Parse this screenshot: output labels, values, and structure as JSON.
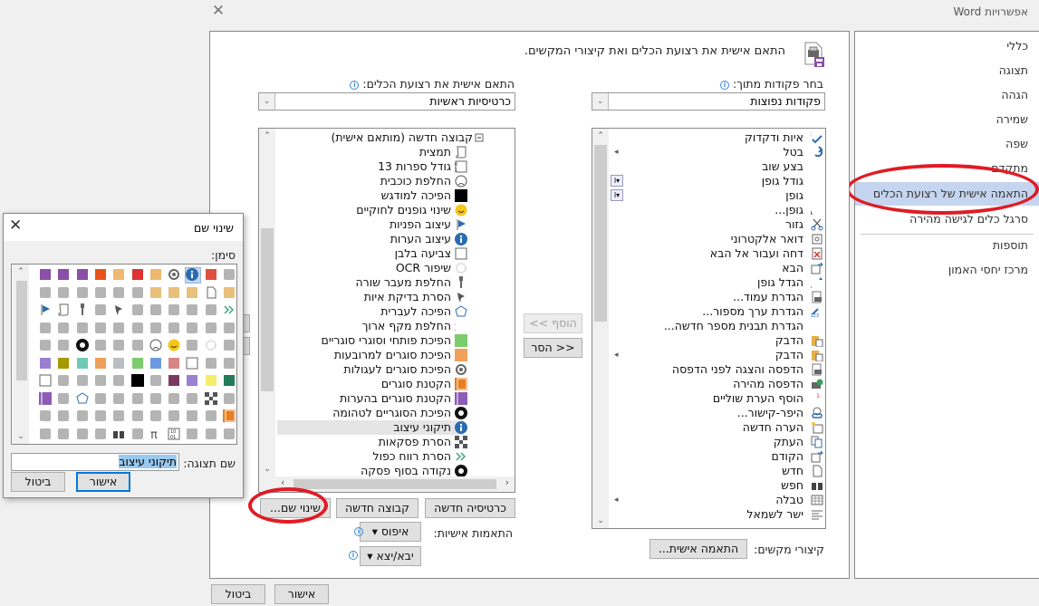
{
  "window": {
    "title": "אפשרויות Word",
    "close_icon": "close-icon"
  },
  "sidebar": {
    "items": [
      {
        "label": "כללי"
      },
      {
        "label": "תצוגה"
      },
      {
        "label": "הגהה"
      },
      {
        "label": "שמירה"
      },
      {
        "label": "שפה"
      },
      {
        "label": "מתקדם"
      },
      {
        "label": "התאמה אישית של רצועת הכלים",
        "selected": true
      },
      {
        "label": "סרגל כלים לגישה מהירה"
      },
      {
        "label": "תוספות"
      },
      {
        "label": "מרכז יחסי האמון"
      }
    ]
  },
  "main": {
    "header": "התאם אישית את רצועת הכלים ואת קיצורי המקשים.",
    "choose_commands_label": "בחר פקודות מתוך:",
    "choose_commands_value": "פקודות נפוצות",
    "customize_ribbon_label": "התאם אישית את רצועת הכלים:",
    "customize_ribbon_value": "כרטיסיות ראשיות",
    "commands_list": [
      {
        "label": "איות ודקדוק",
        "icon": "spelling-icon"
      },
      {
        "label": "בטל",
        "icon": "undo-icon",
        "submenu": true
      },
      {
        "label": "בצע שוב",
        "icon": ""
      },
      {
        "label": "גודל גופן",
        "icon": "",
        "picker": true
      },
      {
        "label": "גופן",
        "icon": "",
        "picker": true
      },
      {
        "label": "גופן...",
        "icon": "font-icon"
      },
      {
        "label": "גזור",
        "icon": "cut-icon"
      },
      {
        "label": "דואר אלקטרוני",
        "icon": "email-icon"
      },
      {
        "label": "דחה ועבור אל הבא",
        "icon": "reject-icon"
      },
      {
        "label": "הבא",
        "icon": "next-icon"
      },
      {
        "label": "הגדל גופן",
        "icon": "grow-font-icon"
      },
      {
        "label": "הגדרת עמוד...",
        "icon": "page-setup-icon"
      },
      {
        "label": "הגדרת ערך מספור...",
        "icon": "numbering-value-icon"
      },
      {
        "label": "הגדרת תבנית מספר חדשה...",
        "icon": ""
      },
      {
        "label": "הדבק",
        "icon": "paste-icon"
      },
      {
        "label": "הדבק",
        "icon": "paste-icon",
        "submenu": true
      },
      {
        "label": "הדפסה והצגה לפני הדפסה",
        "icon": "print-preview-icon"
      },
      {
        "label": "הדפסה מהירה",
        "icon": "quick-print-icon"
      },
      {
        "label": "הוסף הערת שוליים",
        "icon": "footnote-icon"
      },
      {
        "label": "היפר-קישור...",
        "icon": "hyperlink-icon"
      },
      {
        "label": "הערה חדשה",
        "icon": "new-comment-icon"
      },
      {
        "label": "העתק",
        "icon": "copy-icon"
      },
      {
        "label": "הקודם",
        "icon": "previous-icon"
      },
      {
        "label": "חדש",
        "icon": "new-document-icon"
      },
      {
        "label": "חפש",
        "icon": "find-icon"
      },
      {
        "label": "טבלה",
        "icon": "table-icon",
        "submenu": true
      },
      {
        "label": "ישר לשמאל",
        "icon": "align-left-icon"
      }
    ],
    "ribbon_tree": [
      {
        "label": "קבוצה חדשה (מותאם אישית)",
        "icon": "collapse-icon",
        "group": true
      },
      {
        "label": "תמצית",
        "icon": "scroll-icon"
      },
      {
        "label": "גודל ספרות 13",
        "icon": "binary-icon"
      },
      {
        "label": "החלפת כוכבית",
        "icon": "sad-face-icon"
      },
      {
        "label": "הפיכה למודגש",
        "icon": "black-square-icon"
      },
      {
        "label": "שינוי גופנים לחוקיים",
        "icon": "smiley-icon"
      },
      {
        "label": "עיצוב הפניות",
        "icon": "flag-icon"
      },
      {
        "label": "עיצוב הערות",
        "icon": "info-icon"
      },
      {
        "label": "צביעה בלבן",
        "icon": "white-square-icon"
      },
      {
        "label": "שיפור OCR",
        "icon": "sparkle-icon"
      },
      {
        "label": "החלפת מעבר שורה",
        "icon": "key-icon"
      },
      {
        "label": "הסרת בדיקת איות",
        "icon": "pushpin-icon"
      },
      {
        "label": "הפיכה לעברית",
        "icon": "radar-icon"
      },
      {
        "label": "החלפת מקף ארוך",
        "icon": "pi-icon"
      },
      {
        "label": "הפיכת פותחי וסוגרי סוגריים",
        "icon": "green-square-icon"
      },
      {
        "label": "הפיכת סוגרים למרובעות",
        "icon": "orange-square-icon"
      },
      {
        "label": "הפיכת סוגרים לעגולות",
        "icon": "target-icon"
      },
      {
        "label": "הקטנת סוגרים",
        "icon": "orange-book-icon"
      },
      {
        "label": "הקטנת סוגרים בהערות",
        "icon": "purple-book-icon"
      },
      {
        "label": "הפיכת הסוגריים לטהומה",
        "icon": "eight-ball-icon"
      },
      {
        "label": "תיקוני עיצוב",
        "icon": "info-icon",
        "selected": true
      },
      {
        "label": "הסרת פסקאות",
        "icon": "checker-icon"
      },
      {
        "label": "הסרת רווח כפול",
        "icon": "double-arrow-icon"
      },
      {
        "label": "נקודה בסוף פסקה",
        "icon": "eight-ball-icon"
      }
    ],
    "add_button": "הוסף >>",
    "remove_button": "<< הסר",
    "new_tab_button": "כרטיסיה חדשה",
    "new_group_button": "קבוצה חדשה",
    "rename_button": "שינוי שם...",
    "customizations_label": "התאמות אישיות:",
    "reset_button": "איפוס",
    "import_export_button": "יבא/יצא",
    "keyboard_shortcuts_label": "קיצורי מקשים:",
    "customize_shortcuts_button": "התאמה אישית..."
  },
  "footer": {
    "ok_button": "אישור",
    "cancel_button": "ביטול"
  },
  "rename_dialog": {
    "title": "שינוי שם",
    "symbol_label": "סימן:",
    "display_name_label": "שם תצוגה:",
    "display_name_value": "תיקוני עיצוב",
    "ok_button": "אישור",
    "cancel_button": "ביטול",
    "selected_symbol": "info-icon"
  },
  "colors": {
    "selection": "#c5d5ef",
    "highlight_ellipse": "#e01b24",
    "primary_border": "#0078d7",
    "list_selected": "#e5e5e5"
  }
}
